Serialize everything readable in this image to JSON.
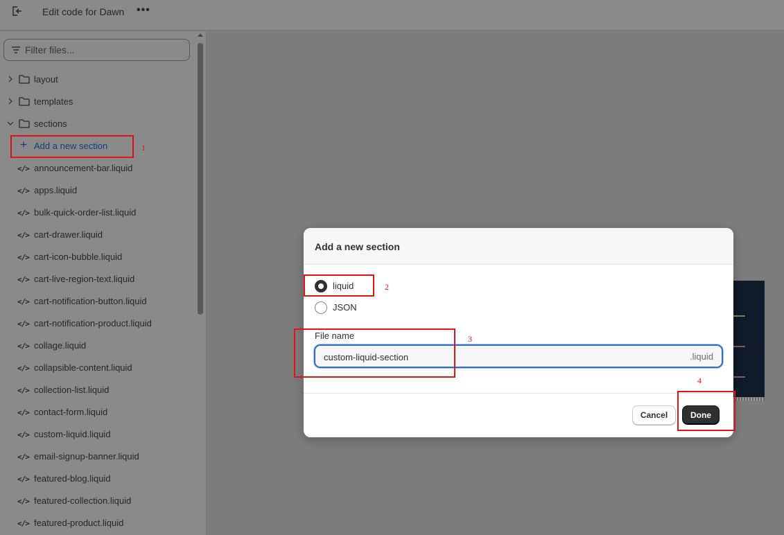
{
  "topbar": {
    "title": "Edit code for Dawn",
    "more": "•••",
    "exit_icon": "exit-icon"
  },
  "sidebar": {
    "filter_placeholder": "Filter files...",
    "folders": [
      {
        "label": "layout",
        "expanded": false
      },
      {
        "label": "templates",
        "expanded": false
      },
      {
        "label": "sections",
        "expanded": true
      }
    ],
    "add_section_label": "Add a new section",
    "files": [
      "announcement-bar.liquid",
      "apps.liquid",
      "bulk-quick-order-list.liquid",
      "cart-drawer.liquid",
      "cart-icon-bubble.liquid",
      "cart-live-region-text.liquid",
      "cart-notification-button.liquid",
      "cart-notification-product.liquid",
      "collage.liquid",
      "collapsible-content.liquid",
      "collection-list.liquid",
      "contact-form.liquid",
      "custom-liquid.liquid",
      "email-signup-banner.liquid",
      "featured-blog.liquid",
      "featured-collection.liquid",
      "featured-product.liquid"
    ],
    "code_glyph": "</>"
  },
  "modal": {
    "title": "Add a new section",
    "options": [
      {
        "label": "liquid",
        "selected": true
      },
      {
        "label": "JSON",
        "selected": false
      }
    ],
    "file_name_label": "File name",
    "file_name_value": "custom-liquid-section",
    "file_suffix": ".liquid",
    "cancel_label": "Cancel",
    "done_label": "Done"
  },
  "annotations": {
    "one": "1",
    "two": "2",
    "three": "3",
    "four": "4",
    "color": "#e01414"
  },
  "colors": {
    "accent_blue": "#2c6ecb",
    "link_blue": "#163d7a",
    "primary_button": "#303030"
  }
}
